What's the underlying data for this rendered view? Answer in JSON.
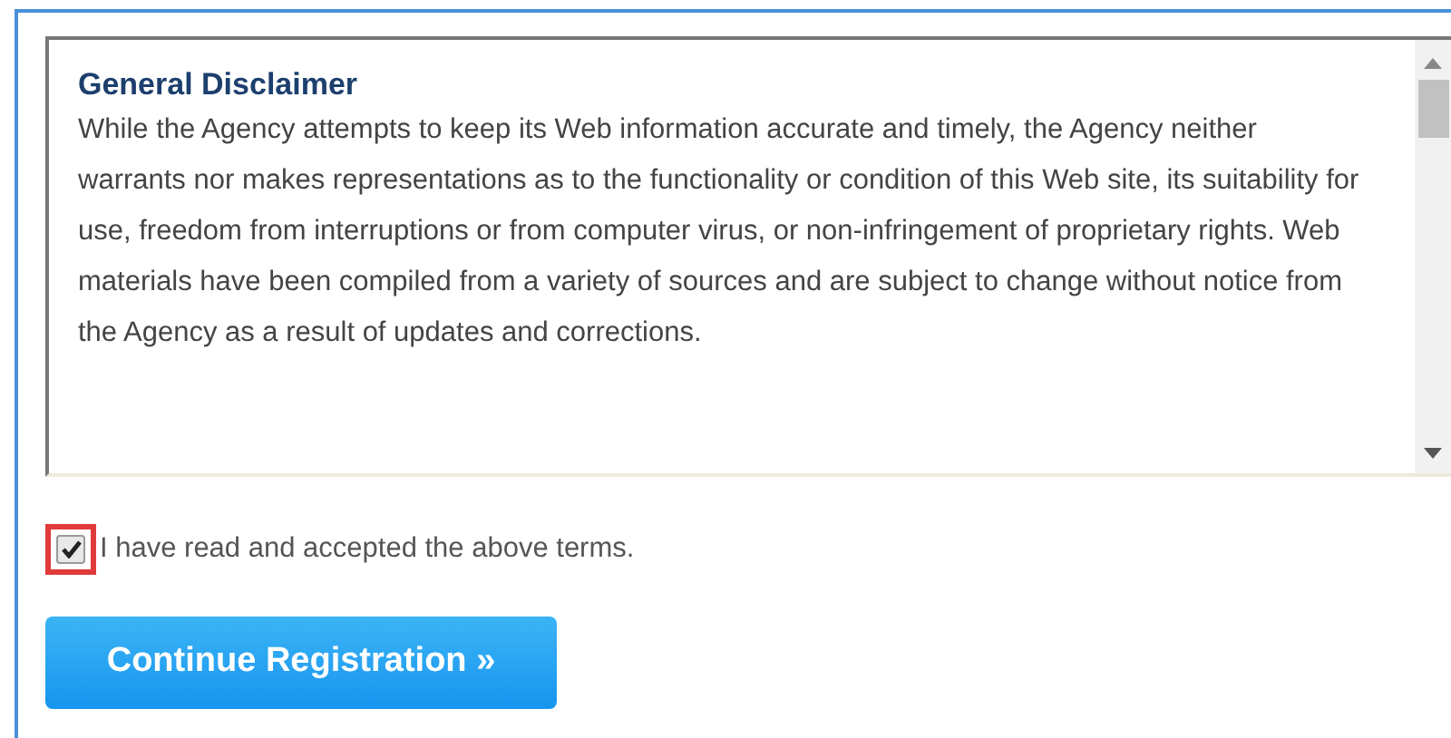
{
  "disclaimer": {
    "title": "General Disclaimer",
    "body": "While the Agency attempts to keep its Web information accurate and timely, the Agency neither warrants nor makes representations as to the functionality or condition of this Web site, its suitability for use, freedom from interruptions or from computer virus, or non-infringement of proprietary rights. Web materials have been compiled from a variety of sources and are subject to change without notice from the Agency as a result of updates and corrections."
  },
  "accept": {
    "label": "I have read and accepted the above terms.",
    "checked": true,
    "highlighted": true
  },
  "button": {
    "label": "Continue Registration »"
  }
}
